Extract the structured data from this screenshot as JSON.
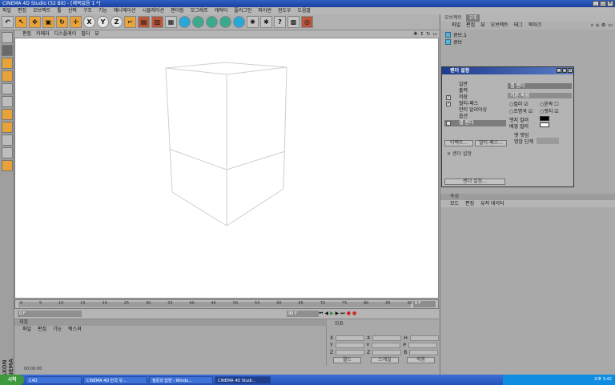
{
  "window": {
    "title": "CINEMA 4D Studio (32 Bit) - [제목없음 1 *]",
    "buttons": [
      "_",
      "□",
      "X"
    ]
  },
  "menu": [
    "파일",
    "편집",
    "오브젝트",
    "툴",
    "선택",
    "구조",
    "기능",
    "애니메이션",
    "시뮬레이션",
    "렌더링",
    "모그래프",
    "캐릭터",
    "플러그인",
    "파이썬",
    "윈도우",
    "도움말"
  ],
  "toolbar": {
    "icons": [
      "undo-icon",
      "select-icon",
      "move-icon",
      "scale-icon",
      "rotate-icon",
      "x-axis",
      "y-axis",
      "z-axis",
      "coord-icon",
      "render-view",
      "render-picture",
      "render-settings",
      "cube-icon",
      "spline-icon",
      "nurbs-icon",
      "array-icon",
      "deformer-icon",
      "scene-icon",
      "light-icon",
      "camera-icon",
      "tags-icon"
    ],
    "axis_x": "X",
    "axis_y": "Y",
    "axis_z": "Z"
  },
  "viewport": {
    "menu": [
      "편집",
      "카메라",
      "디스플레이",
      "필터",
      "뷰"
    ]
  },
  "timeline": {
    "ticks": [
      "0",
      "5",
      "10",
      "15",
      "20",
      "25",
      "30",
      "35",
      "40",
      "45",
      "50",
      "55",
      "60",
      "65",
      "70",
      "75",
      "80",
      "85",
      "90"
    ],
    "end_frame": "0 F",
    "start_field": "0 F",
    "end_field": "90 F"
  },
  "material": {
    "header": "재질",
    "menu": [
      "파일",
      "편집",
      "기능",
      "텍스쳐"
    ]
  },
  "coords": {
    "header": "좌표",
    "rows": [
      [
        "X",
        "X",
        "H"
      ],
      [
        "Y",
        "Y",
        "P"
      ],
      [
        "Z",
        "Z",
        "B"
      ]
    ],
    "mode1": "월드",
    "mode2": "스케일",
    "apply": "적용"
  },
  "status": {
    "time": "00:00:00"
  },
  "maxon": "MAXON CINEMA 4D",
  "objects": {
    "tabs": [
      "오브젝트",
      "구조"
    ],
    "menu": [
      "파일",
      "편집",
      "뷰",
      "오브젝트",
      "태그",
      "북마크"
    ],
    "items": [
      "큐브.1",
      "큐브"
    ]
  },
  "attributes": {
    "header": "속성",
    "menu": [
      "모드",
      "편집",
      "유저 데이터"
    ]
  },
  "render_dialog": {
    "title": "렌더 설정",
    "list": [
      "일반",
      "출력",
      "저장",
      "멀티-패스",
      "안티 알리아싱",
      "옵션",
      "셀 렌더"
    ],
    "checked": [
      false,
      false,
      true,
      true,
      false,
      false,
      true
    ],
    "selected": 6,
    "effect_btn": "이펙트...",
    "multipass_btn": "멀티-패스...",
    "settings_btn": "렌더 설정...",
    "sub_item": "렌더 설정",
    "right_header": "셀 렌더",
    "section": "기본 속성",
    "color_label": "컬러",
    "outline_label": "윤곽",
    "illum_label": "조명색",
    "edge_label": "엣지",
    "edge_color": "엣지 컬러",
    "bg_color": "배경 컬러",
    "edge_light": "엣 엣잉",
    "shadow_level": "명암 단계"
  },
  "taskbar": {
    "start": "시작",
    "items": [
      "C4D",
      "CINEMA 4D 한국 유...",
      "질문과 답변 - Windo...",
      "CINEMA 4D Studi..."
    ],
    "clock": "오후 3:42"
  },
  "colors": {
    "accent": "#e7a23a",
    "title": "#1b3f9c"
  }
}
